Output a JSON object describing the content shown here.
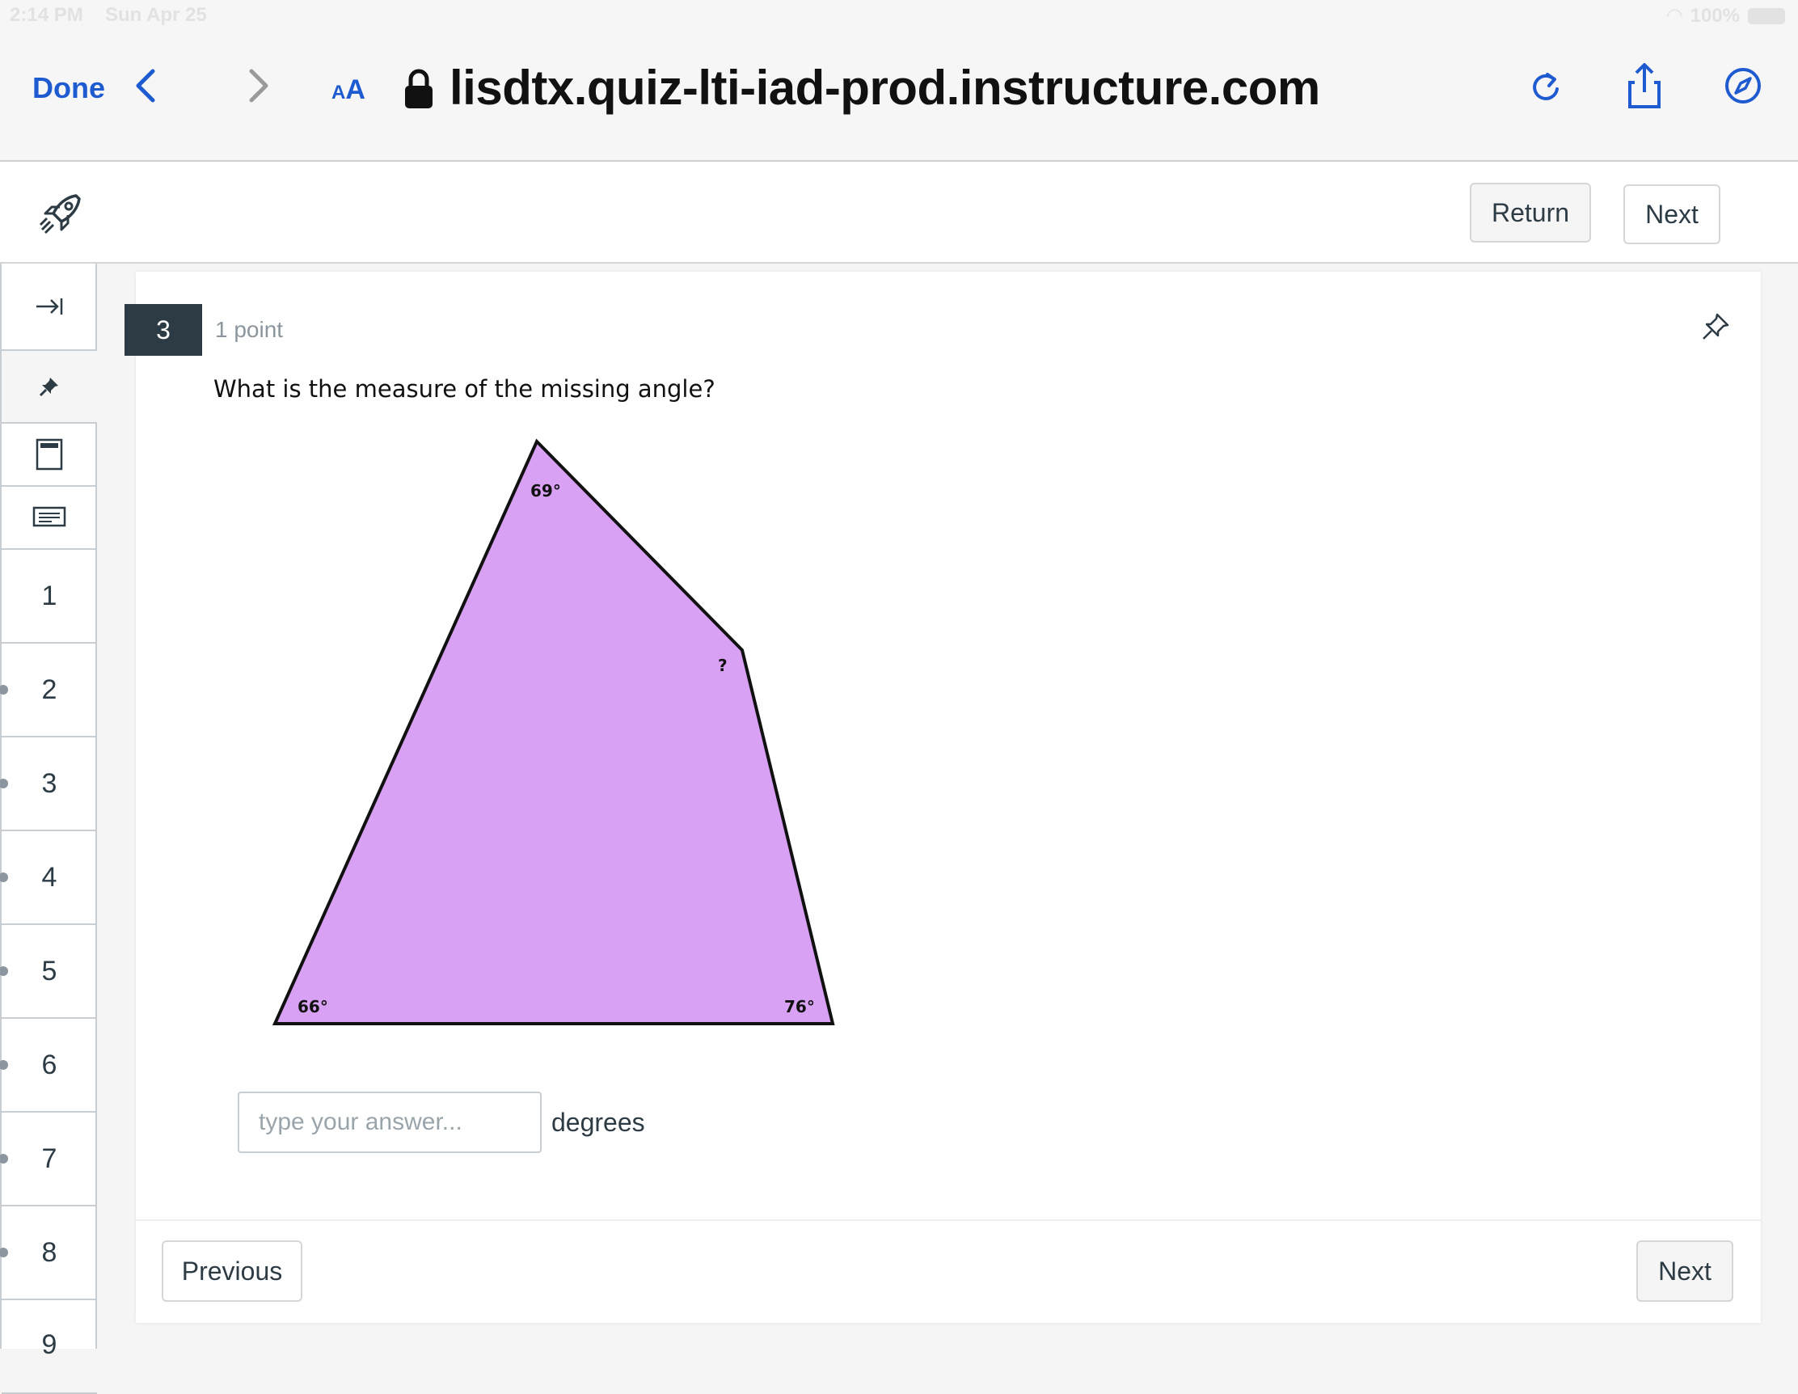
{
  "status_bar": {
    "time": "2:14 PM",
    "date": "Sun Apr 25",
    "battery": "100%"
  },
  "browser": {
    "done_label": "Done",
    "text_size_small": "A",
    "text_size_large": "A",
    "url": "lisdtx.quiz-lti-iad-prod.instructure.com"
  },
  "header": {
    "return_label": "Return",
    "next_label": "Next"
  },
  "sidebar": {
    "questions": [
      "1",
      "2",
      "3",
      "4",
      "5",
      "6",
      "7",
      "8",
      "9"
    ]
  },
  "question": {
    "number": "3",
    "points": "1 point",
    "text": "What is the measure of the missing angle?",
    "angles": {
      "top": "69°",
      "right": "?",
      "bottom_left": "66°",
      "bottom_right": "76°"
    },
    "shape_fill": "#d8a1f3",
    "answer_placeholder": "type your answer...",
    "unit_label": "degrees"
  },
  "footer": {
    "previous_label": "Previous",
    "next_label": "Next"
  },
  "colors": {
    "accent": "#1f5bd0",
    "dark": "#2d3b45"
  }
}
